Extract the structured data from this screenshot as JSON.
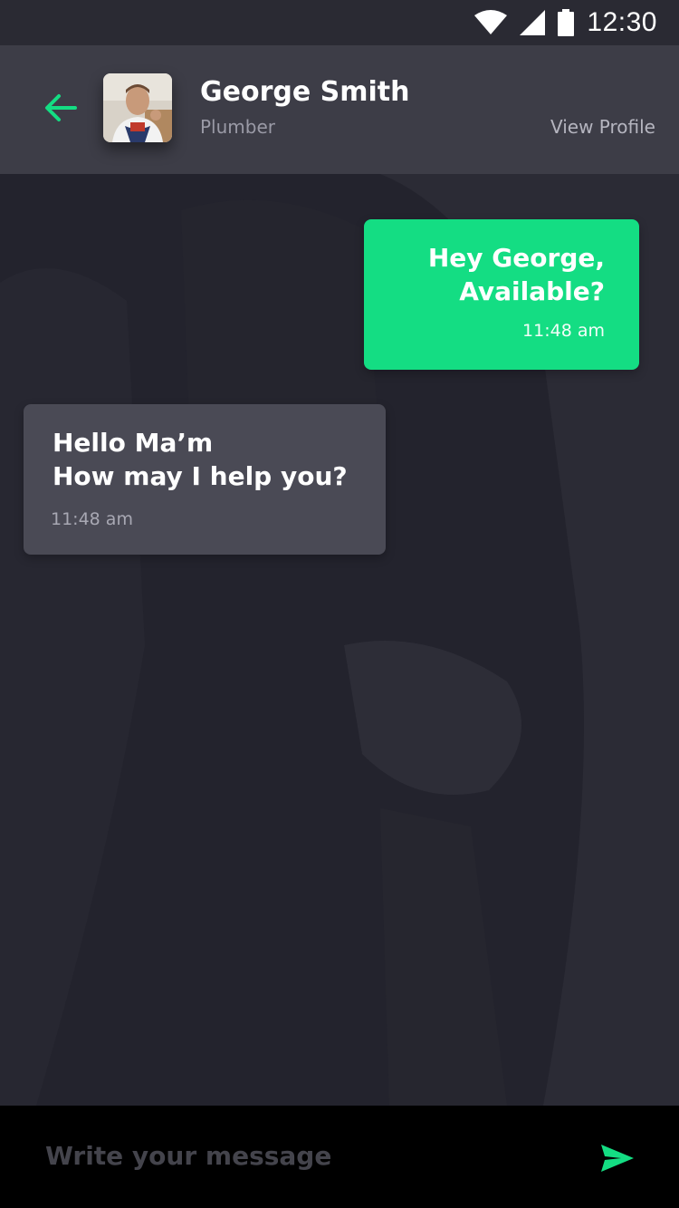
{
  "status_bar": {
    "time": "12:30",
    "icons": [
      "wifi-icon",
      "signal-icon",
      "battery-icon"
    ]
  },
  "header": {
    "back_icon": "arrow-left-icon",
    "contact_name": "George Smith",
    "contact_role": "Plumber",
    "view_profile_label": "View Profile"
  },
  "messages": [
    {
      "direction": "outgoing",
      "text": "Hey George,\nAvailable?",
      "time": "11:48 am"
    },
    {
      "direction": "incoming",
      "text": "Hello Ma’m\nHow may I help you?",
      "time": "11:48 am"
    }
  ],
  "composer": {
    "placeholder": "Write your message",
    "send_icon": "send-icon"
  },
  "colors": {
    "accent": "#14dd83",
    "header_bg": "#3d3d47",
    "status_bar_bg": "#2a2a33",
    "incoming_bubble": "#4a4a55",
    "chat_bg": "#23232d",
    "composer_bg": "#000000"
  }
}
